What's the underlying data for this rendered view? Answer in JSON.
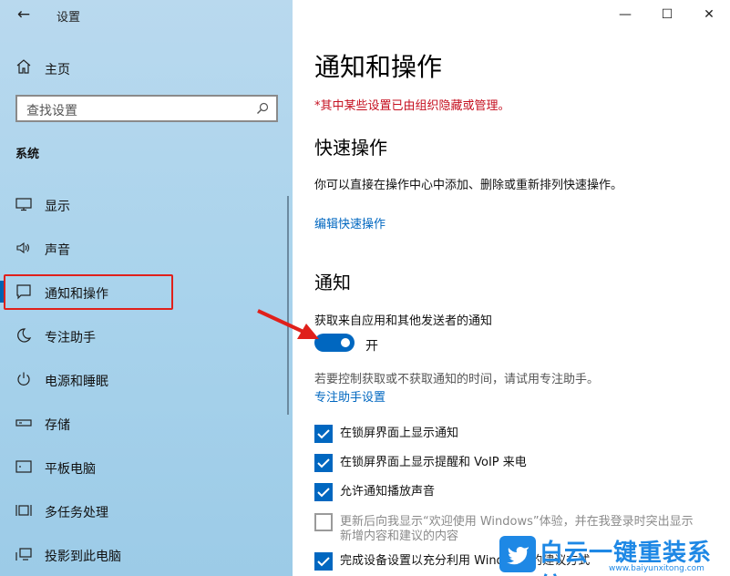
{
  "window": {
    "title": "设置",
    "controls": {
      "minimize": "—",
      "maximize": "☐",
      "close": "✕"
    }
  },
  "sidebar": {
    "back_icon": "back-arrow-icon",
    "home": {
      "label": "主页",
      "icon": "home-icon"
    },
    "search": {
      "placeholder": "查找设置",
      "icon": "search-icon"
    },
    "section_label": "系统",
    "items": [
      {
        "label": "显示",
        "icon": "monitor-icon"
      },
      {
        "label": "声音",
        "icon": "speaker-icon"
      },
      {
        "label": "通知和操作",
        "icon": "notification-icon",
        "selected": true
      },
      {
        "label": "专注助手",
        "icon": "moon-icon"
      },
      {
        "label": "电源和睡眠",
        "icon": "power-icon"
      },
      {
        "label": "存储",
        "icon": "storage-icon"
      },
      {
        "label": "平板电脑",
        "icon": "tablet-icon"
      },
      {
        "label": "多任务处理",
        "icon": "multitask-icon"
      },
      {
        "label": "投影到此电脑",
        "icon": "project-icon"
      }
    ]
  },
  "main": {
    "title": "通知和操作",
    "managed_warning": "*其中某些设置已由组织隐藏或管理。",
    "quick_actions": {
      "heading": "快速操作",
      "description": "你可以直接在操作中心中添加、删除或重新排列快速操作。",
      "edit_link": "编辑快速操作"
    },
    "notifications": {
      "heading": "通知",
      "toggle_label": "获取来自应用和其他发送者的通知",
      "toggle_state": "开",
      "toggle_on": true,
      "focus_hint": "若要控制获取或不获取通知的时间，请试用专注助手。",
      "focus_link": "专注助手设置",
      "checkboxes": [
        {
          "label": "在锁屏界面上显示通知",
          "checked": true
        },
        {
          "label": "在锁屏界面上显示提醒和 VoIP 来电",
          "checked": true
        },
        {
          "label": "允许通知播放声音",
          "checked": true
        },
        {
          "label_line1": "更新后向我显示“欢迎使用 Windows”体验，并在我登录时突出显示",
          "label_line2": "新增内容和建议的内容",
          "checked": false
        },
        {
          "label": "完成设备设置以充分利用 Windows 的建议方式",
          "checked": true
        }
      ]
    }
  },
  "watermark": {
    "text": "白云一键重装系统",
    "url": "www.baiyunxitong.com"
  },
  "colors": {
    "accent": "#0067c0",
    "warning": "#c50f1f",
    "highlight": "#e0201b"
  }
}
